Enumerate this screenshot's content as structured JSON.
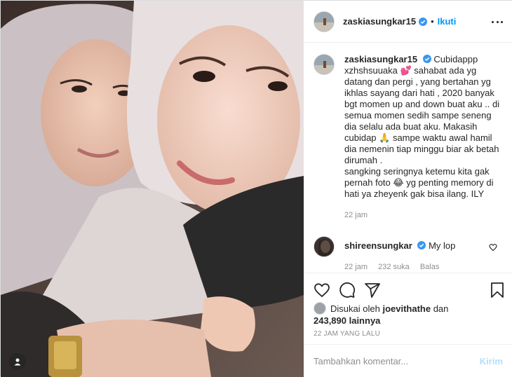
{
  "header": {
    "username": "zaskiasungkar15",
    "separator": "•",
    "follow_label": "Ikuti"
  },
  "caption": {
    "username": "zaskiasungkar15",
    "text": "Cubidappp xzhshsuuaka 💕 sahabat ada yg datang dan pergi , yang bertahan yg ikhlas sayang dari hati , 2020 banyak bgt momen up and down buat aku .. di semua momen sedih sampe seneng dia selalu ada buat aku. Makasih cubidap 🙏 sampe waktu awal hamil dia nemenin tiap minggu biar ak betah dirumah .\nsangking seringnya ketemu kita gak pernah foto 😂 yg penting memory di hati ya zheyenk gak bisa ilang. ILY",
    "time": "22 jam"
  },
  "comment": {
    "username": "shireensungkar",
    "text": "My lop",
    "time": "22 jam",
    "likes": "232 suka",
    "reply_label": "Balas"
  },
  "likes": {
    "prefix": "Disukai oleh",
    "user": "joevithathe",
    "mid": "dan",
    "count": "243,890 lainnya"
  },
  "timestamp": "22 JAM YANG LALU",
  "add_comment": {
    "placeholder": "Tambahkan komentar...",
    "post_label": "Kirim"
  },
  "colors": {
    "accent": "#0095f6",
    "verified": "#3897f0",
    "muted": "#8e8e8e",
    "post_disabled": "#b2dffc"
  },
  "icons": [
    "heart-icon",
    "comment-icon",
    "share-icon",
    "bookmark-icon",
    "more-icon",
    "verified-icon",
    "user-tag-icon"
  ]
}
